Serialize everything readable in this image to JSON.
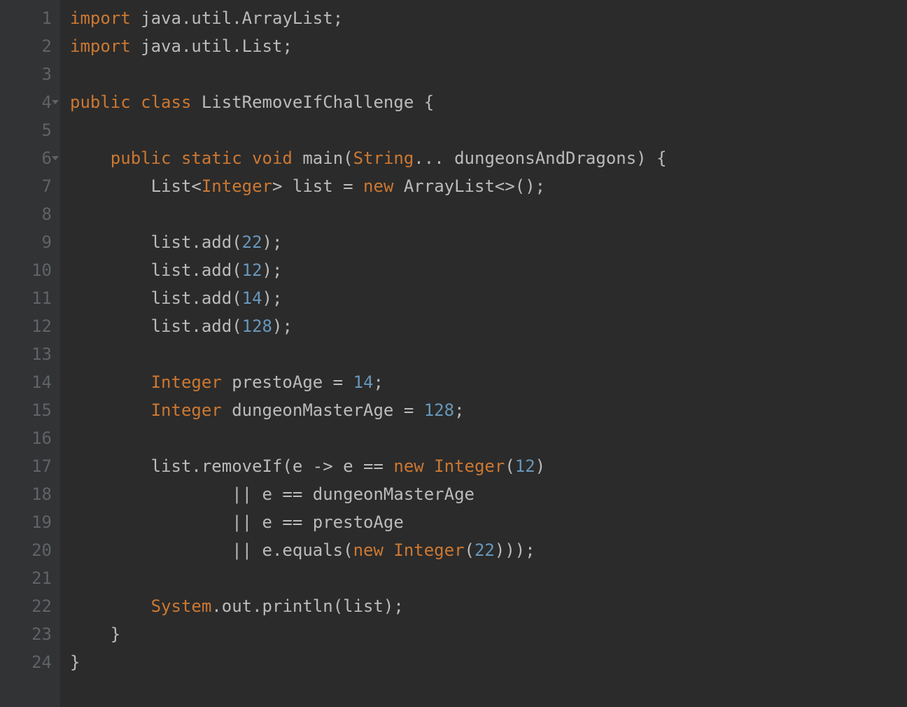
{
  "language": "java",
  "theme": {
    "background": "#2b2b2b",
    "gutter_background": "#313335",
    "gutter_foreground": "#606366",
    "default_text": "#a9b7c6",
    "keyword": "#cc7832",
    "number": "#6897bb"
  },
  "fold_markers": [
    4,
    6
  ],
  "line_numbers": [
    "1",
    "2",
    "3",
    "4",
    "5",
    "6",
    "7",
    "8",
    "9",
    "10",
    "11",
    "12",
    "13",
    "14",
    "15",
    "16",
    "17",
    "18",
    "19",
    "20",
    "21",
    "22",
    "23",
    "24"
  ],
  "lines": [
    [
      {
        "t": "import ",
        "c": "kw"
      },
      {
        "t": "java.util.ArrayList;",
        "c": "plain"
      }
    ],
    [
      {
        "t": "import ",
        "c": "kw"
      },
      {
        "t": "java.util.List;",
        "c": "plain"
      }
    ],
    [
      {
        "t": "",
        "c": "plain"
      }
    ],
    [
      {
        "t": "public class ",
        "c": "kw"
      },
      {
        "t": "ListRemoveIfChallenge ",
        "c": "plain"
      },
      {
        "t": "{",
        "c": "plain"
      }
    ],
    [
      {
        "t": "",
        "c": "plain"
      }
    ],
    [
      {
        "t": "    ",
        "c": "plain"
      },
      {
        "t": "public static void ",
        "c": "kw"
      },
      {
        "t": "main(",
        "c": "plain"
      },
      {
        "t": "String",
        "c": "type"
      },
      {
        "t": "... dungeonsAndDragons) {",
        "c": "plain"
      }
    ],
    [
      {
        "t": "        List<",
        "c": "plain"
      },
      {
        "t": "Integer",
        "c": "type"
      },
      {
        "t": "> list = ",
        "c": "plain"
      },
      {
        "t": "new ",
        "c": "kw"
      },
      {
        "t": "ArrayList<>();",
        "c": "plain"
      }
    ],
    [
      {
        "t": "",
        "c": "plain"
      }
    ],
    [
      {
        "t": "        list.add(",
        "c": "plain"
      },
      {
        "t": "22",
        "c": "num"
      },
      {
        "t": ");",
        "c": "plain"
      }
    ],
    [
      {
        "t": "        list.add(",
        "c": "plain"
      },
      {
        "t": "12",
        "c": "num"
      },
      {
        "t": ");",
        "c": "plain"
      }
    ],
    [
      {
        "t": "        list.add(",
        "c": "plain"
      },
      {
        "t": "14",
        "c": "num"
      },
      {
        "t": ");",
        "c": "plain"
      }
    ],
    [
      {
        "t": "        list.add(",
        "c": "plain"
      },
      {
        "t": "128",
        "c": "num"
      },
      {
        "t": ");",
        "c": "plain"
      }
    ],
    [
      {
        "t": "",
        "c": "plain"
      }
    ],
    [
      {
        "t": "        ",
        "c": "plain"
      },
      {
        "t": "Integer ",
        "c": "type"
      },
      {
        "t": "prestoAge = ",
        "c": "plain"
      },
      {
        "t": "14",
        "c": "num"
      },
      {
        "t": ";",
        "c": "plain"
      }
    ],
    [
      {
        "t": "        ",
        "c": "plain"
      },
      {
        "t": "Integer ",
        "c": "type"
      },
      {
        "t": "dungeonMasterAge = ",
        "c": "plain"
      },
      {
        "t": "128",
        "c": "num"
      },
      {
        "t": ";",
        "c": "plain"
      }
    ],
    [
      {
        "t": "",
        "c": "plain"
      }
    ],
    [
      {
        "t": "        list.removeIf(e -> e == ",
        "c": "plain"
      },
      {
        "t": "new ",
        "c": "kw"
      },
      {
        "t": "Integer",
        "c": "type"
      },
      {
        "t": "(",
        "c": "plain"
      },
      {
        "t": "12",
        "c": "num"
      },
      {
        "t": ")",
        "c": "plain"
      }
    ],
    [
      {
        "t": "                || e == dungeonMasterAge",
        "c": "plain"
      }
    ],
    [
      {
        "t": "                || e == prestoAge",
        "c": "plain"
      }
    ],
    [
      {
        "t": "                || e.equals(",
        "c": "plain"
      },
      {
        "t": "new ",
        "c": "kw"
      },
      {
        "t": "Integer",
        "c": "type"
      },
      {
        "t": "(",
        "c": "plain"
      },
      {
        "t": "22",
        "c": "num"
      },
      {
        "t": ")));",
        "c": "plain"
      }
    ],
    [
      {
        "t": "",
        "c": "plain"
      }
    ],
    [
      {
        "t": "        ",
        "c": "plain"
      },
      {
        "t": "System",
        "c": "type"
      },
      {
        "t": ".out.println(list);",
        "c": "plain"
      }
    ],
    [
      {
        "t": "    }",
        "c": "plain"
      }
    ],
    [
      {
        "t": "}",
        "c": "plain"
      }
    ]
  ]
}
